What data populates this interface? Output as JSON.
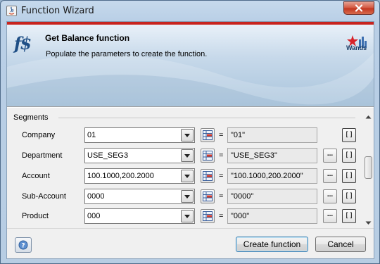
{
  "window": {
    "title": "Function Wizard",
    "close_icon": "close-icon"
  },
  "header": {
    "icon": "fs-function-icon",
    "icon_text": "f$",
    "title": "Get Balance function",
    "subtitle": "Populate the parameters to create the function.",
    "logo_text": "Wands",
    "accent_color": "#c8241e"
  },
  "segments": {
    "label": "Segments",
    "rows": [
      {
        "label": "Company",
        "value": "01",
        "equals": "=",
        "result": "\"01\"",
        "has_dots": false,
        "bracket": "[]"
      },
      {
        "label": "Department",
        "value": "USE_SEG3",
        "equals": "=",
        "result": "\"USE_SEG3\"",
        "has_dots": true,
        "dots": "...",
        "bracket": "[]"
      },
      {
        "label": "Account",
        "value": "100.1000,200.2000",
        "equals": "=",
        "result": "\"100.1000,200.2000\"",
        "has_dots": true,
        "dots": "...",
        "bracket": "[]"
      },
      {
        "label": "Sub-Account",
        "value": "0000",
        "equals": "=",
        "result": "\"0000\"",
        "has_dots": true,
        "dots": "...",
        "bracket": "[]"
      },
      {
        "label": "Product",
        "value": "000",
        "equals": "=",
        "result": "\"000\"",
        "has_dots": true,
        "dots": "...",
        "bracket": "[]"
      }
    ]
  },
  "footer": {
    "help_icon": "help-icon",
    "create_label": "Create function",
    "cancel_label": "Cancel"
  }
}
